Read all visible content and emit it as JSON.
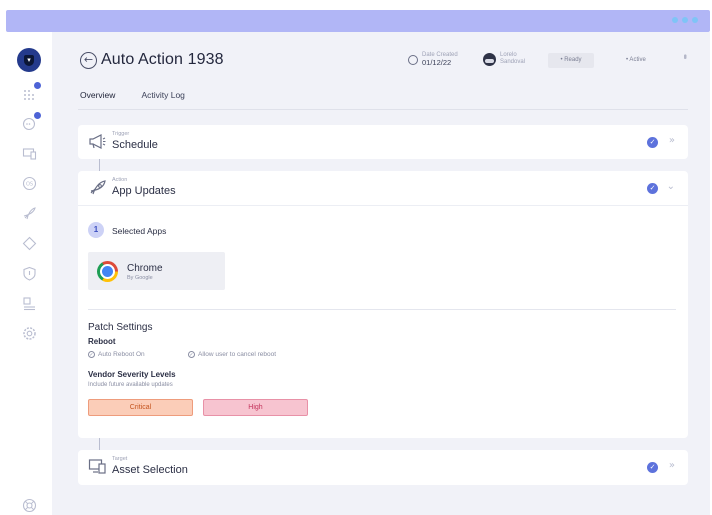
{
  "header": {
    "title": "Auto Action 1938",
    "date_created_label": "Date Created",
    "date_created_value": "01/12/22",
    "owner_first": "Lorelo",
    "owner_last": "Sandoval",
    "ready_label": "• Ready",
    "status_label": "• Active"
  },
  "tabs": [
    {
      "label": "Overview",
      "active": true
    },
    {
      "label": "Activity Log",
      "active": false
    }
  ],
  "trigger": {
    "kicker": "Trigger",
    "title": "Schedule"
  },
  "action": {
    "kicker": "Action",
    "title": "App Updates",
    "step_number": "1",
    "step_label": "Selected Apps",
    "app": {
      "name": "Chrome",
      "vendor": "By Google"
    },
    "patch_title": "Patch Settings",
    "reboot_label": "Reboot",
    "reboot_options": [
      "Auto Reboot On",
      "Allow user to cancel reboot"
    ],
    "vendor_title": "Vendor Severity Levels",
    "vendor_sub": "Include future available updates",
    "severity": [
      "Critical",
      "High"
    ]
  },
  "target": {
    "kicker": "Target",
    "title": "Asset Selection"
  },
  "colors": {
    "accent": "#5d72dc",
    "topbar": "#b1b6f6",
    "critical": "#fbcdb8",
    "high": "#f7c4d0"
  },
  "icons": {
    "sidebar": [
      "grid-icon",
      "chat-icon",
      "devices-icon",
      "os-icon",
      "rocket-icon",
      "diamond-icon",
      "shield-icon",
      "users-icon",
      "settings-icon",
      "help-icon"
    ]
  }
}
